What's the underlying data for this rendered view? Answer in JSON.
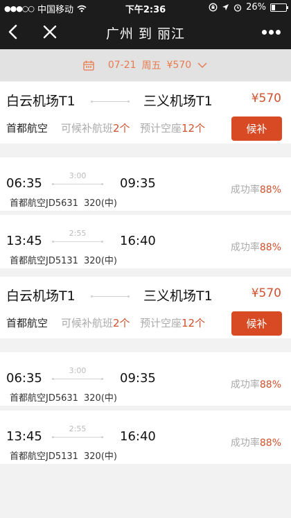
{
  "status_bar": {
    "carrier": "中国移动",
    "time": "下午2:36",
    "battery": "26%",
    "battery_level": 0.26
  },
  "nav": {
    "title": "广州 到 丽江"
  },
  "date_bar": {
    "date": "07-21",
    "weekday": "周五",
    "price": "¥570"
  },
  "colors": {
    "accent": "#d84a24",
    "price": "#d0502c",
    "date_text": "#e87a4f"
  },
  "groups": [
    {
      "route": {
        "from": "白云机场T1",
        "to": "三义机场T1",
        "price": "¥570",
        "airline": "首都航空",
        "alt_label": "可候补航班",
        "alt_count": "2个",
        "seat_label": "预计空座",
        "seat_count": "12个",
        "button": "候补"
      },
      "flights": [
        {
          "dep": "06:35",
          "arr": "09:35",
          "duration": "3:00",
          "flight_no": "首都航空JD5631",
          "aircraft": "320(中)",
          "rate_label": "成功率",
          "rate": "88%"
        },
        {
          "dep": "13:45",
          "arr": "16:40",
          "duration": "2:55",
          "flight_no": "首都航空JD5131",
          "aircraft": "320(中)",
          "rate_label": "成功率",
          "rate": "88%"
        }
      ]
    },
    {
      "route": {
        "from": "白云机场T1",
        "to": "三义机场T1",
        "price": "¥570",
        "airline": "首都航空",
        "alt_label": "可候补航班",
        "alt_count": "2个",
        "seat_label": "预计空座",
        "seat_count": "12个",
        "button": "候补"
      },
      "flights": [
        {
          "dep": "06:35",
          "arr": "09:35",
          "duration": "3:00",
          "flight_no": "首都航空JD5631",
          "aircraft": "320(中)",
          "rate_label": "成功率",
          "rate": "88%"
        },
        {
          "dep": "13:45",
          "arr": "16:40",
          "duration": "2:55",
          "flight_no": "首都航空JD5131",
          "aircraft": "320(中)",
          "rate_label": "成功率",
          "rate": "88%"
        }
      ]
    }
  ]
}
